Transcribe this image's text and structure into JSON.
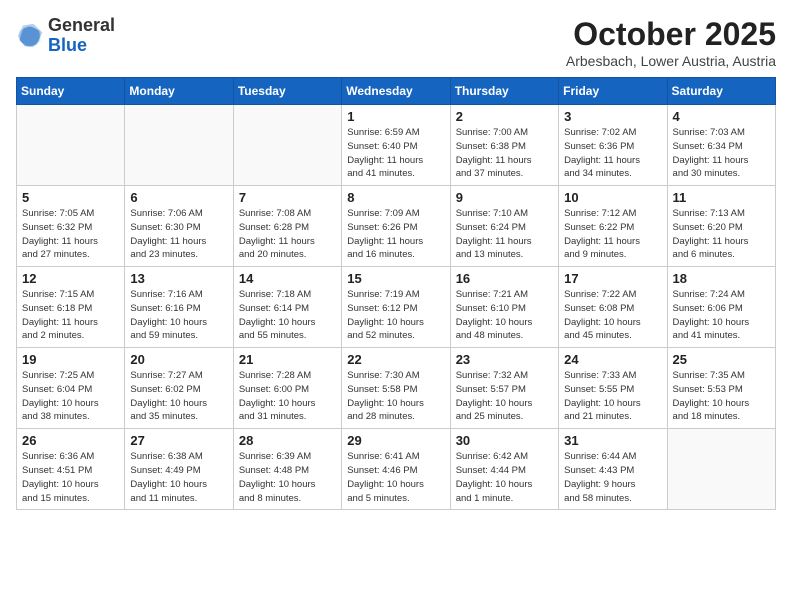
{
  "header": {
    "logo_general": "General",
    "logo_blue": "Blue",
    "month_title": "October 2025",
    "subtitle": "Arbesbach, Lower Austria, Austria"
  },
  "weekdays": [
    "Sunday",
    "Monday",
    "Tuesday",
    "Wednesday",
    "Thursday",
    "Friday",
    "Saturday"
  ],
  "weeks": [
    [
      {
        "day": "",
        "info": ""
      },
      {
        "day": "",
        "info": ""
      },
      {
        "day": "",
        "info": ""
      },
      {
        "day": "1",
        "info": "Sunrise: 6:59 AM\nSunset: 6:40 PM\nDaylight: 11 hours\nand 41 minutes."
      },
      {
        "day": "2",
        "info": "Sunrise: 7:00 AM\nSunset: 6:38 PM\nDaylight: 11 hours\nand 37 minutes."
      },
      {
        "day": "3",
        "info": "Sunrise: 7:02 AM\nSunset: 6:36 PM\nDaylight: 11 hours\nand 34 minutes."
      },
      {
        "day": "4",
        "info": "Sunrise: 7:03 AM\nSunset: 6:34 PM\nDaylight: 11 hours\nand 30 minutes."
      }
    ],
    [
      {
        "day": "5",
        "info": "Sunrise: 7:05 AM\nSunset: 6:32 PM\nDaylight: 11 hours\nand 27 minutes."
      },
      {
        "day": "6",
        "info": "Sunrise: 7:06 AM\nSunset: 6:30 PM\nDaylight: 11 hours\nand 23 minutes."
      },
      {
        "day": "7",
        "info": "Sunrise: 7:08 AM\nSunset: 6:28 PM\nDaylight: 11 hours\nand 20 minutes."
      },
      {
        "day": "8",
        "info": "Sunrise: 7:09 AM\nSunset: 6:26 PM\nDaylight: 11 hours\nand 16 minutes."
      },
      {
        "day": "9",
        "info": "Sunrise: 7:10 AM\nSunset: 6:24 PM\nDaylight: 11 hours\nand 13 minutes."
      },
      {
        "day": "10",
        "info": "Sunrise: 7:12 AM\nSunset: 6:22 PM\nDaylight: 11 hours\nand 9 minutes."
      },
      {
        "day": "11",
        "info": "Sunrise: 7:13 AM\nSunset: 6:20 PM\nDaylight: 11 hours\nand 6 minutes."
      }
    ],
    [
      {
        "day": "12",
        "info": "Sunrise: 7:15 AM\nSunset: 6:18 PM\nDaylight: 11 hours\nand 2 minutes."
      },
      {
        "day": "13",
        "info": "Sunrise: 7:16 AM\nSunset: 6:16 PM\nDaylight: 10 hours\nand 59 minutes."
      },
      {
        "day": "14",
        "info": "Sunrise: 7:18 AM\nSunset: 6:14 PM\nDaylight: 10 hours\nand 55 minutes."
      },
      {
        "day": "15",
        "info": "Sunrise: 7:19 AM\nSunset: 6:12 PM\nDaylight: 10 hours\nand 52 minutes."
      },
      {
        "day": "16",
        "info": "Sunrise: 7:21 AM\nSunset: 6:10 PM\nDaylight: 10 hours\nand 48 minutes."
      },
      {
        "day": "17",
        "info": "Sunrise: 7:22 AM\nSunset: 6:08 PM\nDaylight: 10 hours\nand 45 minutes."
      },
      {
        "day": "18",
        "info": "Sunrise: 7:24 AM\nSunset: 6:06 PM\nDaylight: 10 hours\nand 41 minutes."
      }
    ],
    [
      {
        "day": "19",
        "info": "Sunrise: 7:25 AM\nSunset: 6:04 PM\nDaylight: 10 hours\nand 38 minutes."
      },
      {
        "day": "20",
        "info": "Sunrise: 7:27 AM\nSunset: 6:02 PM\nDaylight: 10 hours\nand 35 minutes."
      },
      {
        "day": "21",
        "info": "Sunrise: 7:28 AM\nSunset: 6:00 PM\nDaylight: 10 hours\nand 31 minutes."
      },
      {
        "day": "22",
        "info": "Sunrise: 7:30 AM\nSunset: 5:58 PM\nDaylight: 10 hours\nand 28 minutes."
      },
      {
        "day": "23",
        "info": "Sunrise: 7:32 AM\nSunset: 5:57 PM\nDaylight: 10 hours\nand 25 minutes."
      },
      {
        "day": "24",
        "info": "Sunrise: 7:33 AM\nSunset: 5:55 PM\nDaylight: 10 hours\nand 21 minutes."
      },
      {
        "day": "25",
        "info": "Sunrise: 7:35 AM\nSunset: 5:53 PM\nDaylight: 10 hours\nand 18 minutes."
      }
    ],
    [
      {
        "day": "26",
        "info": "Sunrise: 6:36 AM\nSunset: 4:51 PM\nDaylight: 10 hours\nand 15 minutes."
      },
      {
        "day": "27",
        "info": "Sunrise: 6:38 AM\nSunset: 4:49 PM\nDaylight: 10 hours\nand 11 minutes."
      },
      {
        "day": "28",
        "info": "Sunrise: 6:39 AM\nSunset: 4:48 PM\nDaylight: 10 hours\nand 8 minutes."
      },
      {
        "day": "29",
        "info": "Sunrise: 6:41 AM\nSunset: 4:46 PM\nDaylight: 10 hours\nand 5 minutes."
      },
      {
        "day": "30",
        "info": "Sunrise: 6:42 AM\nSunset: 4:44 PM\nDaylight: 10 hours\nand 1 minute."
      },
      {
        "day": "31",
        "info": "Sunrise: 6:44 AM\nSunset: 4:43 PM\nDaylight: 9 hours\nand 58 minutes."
      },
      {
        "day": "",
        "info": ""
      }
    ]
  ]
}
